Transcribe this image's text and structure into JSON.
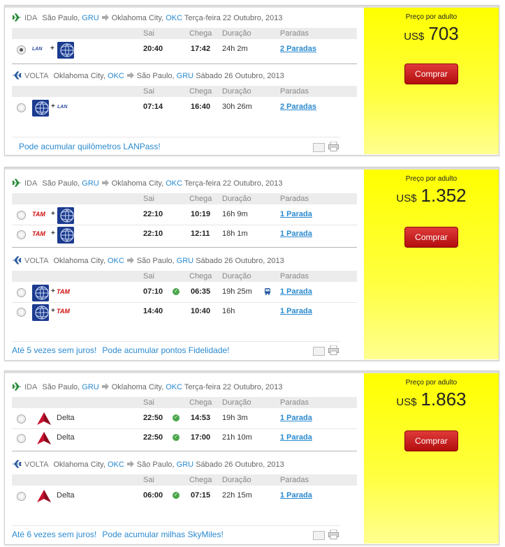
{
  "common": {
    "price_label": "Preço por adulto",
    "currency": "US$",
    "buy_label": "Comprar",
    "ida_label": "IDA",
    "volta_label": "VOLTA",
    "col_sai": "Sai",
    "col_chega": "Chega",
    "col_duracao": "Duração",
    "col_paradas": "Paradas",
    "origin_city": "São Paulo,",
    "origin_code": "GRU",
    "dest_city": "Oklahoma City,",
    "dest_code": "OKC",
    "out_date": "Terça-feira 22 Outubro, 2013",
    "ret_date": "Sábado 26 Outubro, 2013"
  },
  "offers": [
    {
      "price": "703",
      "outbound": [
        {
          "airline": "LAN + United",
          "sai": "20:40",
          "chega": "17:42",
          "duracao": "24h 2m",
          "paradas": "2 Paradas",
          "selected": true
        }
      ],
      "return": [
        {
          "airline": "United + LAN",
          "sai": "07:14",
          "chega": "16:40",
          "duracao": "30h 26m",
          "paradas": "2 Paradas",
          "selected": false
        }
      ],
      "footer": [
        "Pode acumular quilômetros LANPass!"
      ]
    },
    {
      "price": "1.352",
      "outbound": [
        {
          "airline": "TAM + United",
          "sai": "22:10",
          "chega": "10:19",
          "duracao": "16h 9m",
          "paradas": "1 Parada"
        },
        {
          "airline": "TAM + United",
          "sai": "22:10",
          "chega": "12:11",
          "duracao": "18h 1m",
          "paradas": "1 Parada"
        }
      ],
      "return": [
        {
          "airline": "United + TAM",
          "sai": "07:10",
          "chega": "06:35",
          "duracao": "19h 25m",
          "paradas": "1 Parada"
        },
        {
          "airline": "United + TAM",
          "sai": "14:40",
          "chega": "10:40",
          "duracao": "16h",
          "paradas": "1 Parada"
        }
      ],
      "footer": [
        "Até 5 vezes sem juros!",
        "Pode acumular pontos Fidelidade!"
      ]
    },
    {
      "price": "1.863",
      "outbound": [
        {
          "airline": "Delta",
          "sai": "22:50",
          "chega": "14:53",
          "duracao": "19h 3m",
          "paradas": "1 Parada"
        },
        {
          "airline": "Delta",
          "sai": "22:50",
          "chega": "17:00",
          "duracao": "21h 10m",
          "paradas": "1 Parada"
        }
      ],
      "return": [
        {
          "airline": "Delta",
          "sai": "06:00",
          "chega": "07:15",
          "duracao": "22h 15m",
          "paradas": "1 Parada"
        }
      ],
      "footer": [
        "Até 6 vezes sem juros!",
        "Pode acumular milhas SkyMiles!"
      ]
    }
  ],
  "colors": {
    "accent_blue": "#2a8ad0",
    "price_bg": "#ffff00",
    "buy_red": "#c41a1a"
  },
  "icons": [
    "plane-outbound-icon",
    "plane-return-icon",
    "arrow-right-icon",
    "email-icon",
    "print-icon",
    "check-icon",
    "bus-icon",
    "united-logo",
    "lan-logo",
    "tam-logo",
    "delta-logo"
  ]
}
